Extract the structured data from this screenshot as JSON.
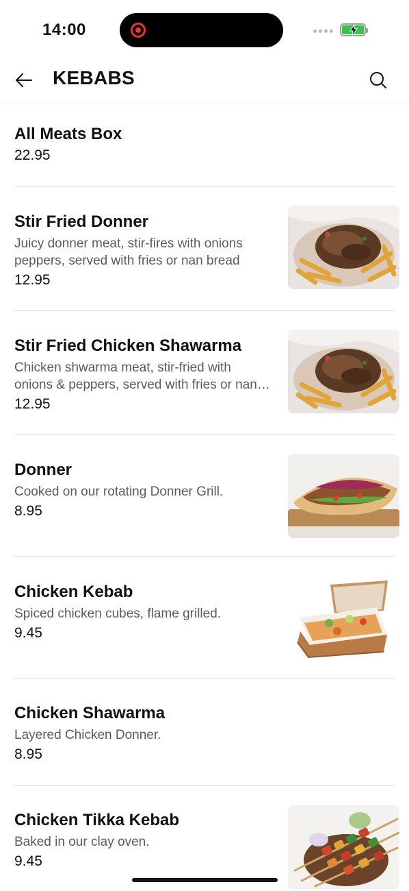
{
  "status_bar": {
    "time": "14:00"
  },
  "header": {
    "title": "KEBABS"
  },
  "menu_items": [
    {
      "name": "All Meats Box",
      "description": "",
      "price": "22.95",
      "image": ""
    },
    {
      "name": "Stir Fried Donner",
      "description": "Juicy donner meat, stir-fires with onions peppers, served with fries or nan bread",
      "price": "12.95",
      "image": "donner-meat-fries-photo"
    },
    {
      "name": "Stir Fried Chicken Shawarma",
      "description": "Chicken shwarma meat, stir-fried with onions & peppers, served with fries or nan bread",
      "price": "12.95",
      "image": "donner-meat-fries-photo"
    },
    {
      "name": "Donner",
      "description": "Cooked on our rotating Donner Grill.",
      "price": "8.95",
      "image": "donner-pita-photo"
    },
    {
      "name": "Chicken Kebab",
      "description": "Spiced chicken cubes, flame grilled.",
      "price": "9.45",
      "image": "chicken-kebab-box-photo"
    },
    {
      "name": "Chicken Shawarma",
      "description": "Layered Chicken Donner.",
      "price": "8.95",
      "image": ""
    },
    {
      "name": "Chicken Tikka Kebab",
      "description": "Baked in our clay oven.",
      "price": "9.45",
      "image": "tikka-skewers-photo"
    }
  ],
  "colors": {
    "accent_red": "#e8372d",
    "battery_green": "#33c748",
    "divider": "#dcdcdc",
    "muted_text": "#5b5b5b"
  }
}
